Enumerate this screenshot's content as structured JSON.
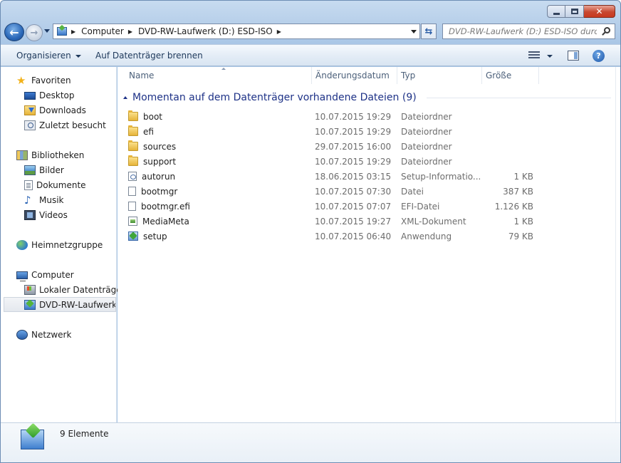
{
  "window": {
    "close_glyph": "✕"
  },
  "nav": {
    "back_glyph": "←",
    "forward_glyph": "→",
    "refresh_glyph": "⇆",
    "breadcrumbs": [
      "Computer",
      "DVD-RW-Laufwerk (D:) ESD-ISO"
    ],
    "search_placeholder": "DVD-RW-Laufwerk (D:) ESD-ISO durc..."
  },
  "toolbar": {
    "organize_label": "Organisieren",
    "burn_label": "Auf Datenträger brennen",
    "help_glyph": "?"
  },
  "sidebar": {
    "favorites": {
      "label": "Favoriten",
      "items": [
        "Desktop",
        "Downloads",
        "Zuletzt besucht"
      ]
    },
    "libraries": {
      "label": "Bibliotheken",
      "items": [
        "Bilder",
        "Dokumente",
        "Musik",
        "Videos"
      ]
    },
    "homegroup": {
      "label": "Heimnetzgruppe"
    },
    "computer": {
      "label": "Computer",
      "items": [
        "Lokaler Datenträger",
        "DVD-RW-Laufwerk ("
      ]
    },
    "network": {
      "label": "Netzwerk"
    }
  },
  "columns": {
    "name": "Name",
    "date": "Änderungsdatum",
    "type": "Typ",
    "size": "Größe"
  },
  "group": {
    "title": "Momentan auf dem Datenträger vorhandene Dateien (9)"
  },
  "files": [
    {
      "name": "boot",
      "date": "10.07.2015 19:29",
      "type": "Dateiordner",
      "size": "",
      "icon": "folder-icon"
    },
    {
      "name": "efi",
      "date": "10.07.2015 19:29",
      "type": "Dateiordner",
      "size": "",
      "icon": "folder-icon"
    },
    {
      "name": "sources",
      "date": "29.07.2015 16:00",
      "type": "Dateiordner",
      "size": "",
      "icon": "folder-icon"
    },
    {
      "name": "support",
      "date": "10.07.2015 19:29",
      "type": "Dateiordner",
      "size": "",
      "icon": "folder-icon"
    },
    {
      "name": "autorun",
      "date": "18.06.2015 03:15",
      "type": "Setup-Informatio...",
      "size": "1 KB",
      "icon": "inf-icon"
    },
    {
      "name": "bootmgr",
      "date": "10.07.2015 07:30",
      "type": "Datei",
      "size": "387 KB",
      "icon": "file-icon"
    },
    {
      "name": "bootmgr.efi",
      "date": "10.07.2015 07:07",
      "type": "EFI-Datei",
      "size": "1.126 KB",
      "icon": "file-icon"
    },
    {
      "name": "MediaMeta",
      "date": "10.07.2015 19:27",
      "type": "XML-Dokument",
      "size": "1 KB",
      "icon": "xml-icon"
    },
    {
      "name": "setup",
      "date": "10.07.2015 06:40",
      "type": "Anwendung",
      "size": "79 KB",
      "icon": "setup-icon"
    }
  ],
  "details": {
    "item_count": "9 Elemente"
  }
}
